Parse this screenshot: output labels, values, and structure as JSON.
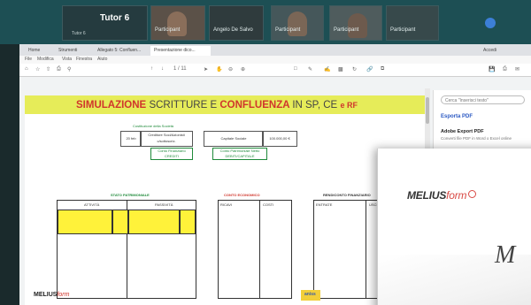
{
  "conference": {
    "tutor_label": "Tutor 6",
    "tutor_sublabel": "Tutor 6",
    "tiles": [
      {
        "name": "Participant"
      },
      {
        "name": "Angelo De Salvo"
      },
      {
        "name": "Participant"
      },
      {
        "name": "Participant"
      },
      {
        "name": "Participant"
      }
    ]
  },
  "browser": {
    "tabs": [
      {
        "label": "Home"
      },
      {
        "label": "Strumenti"
      },
      {
        "label": "Allegato 5: Confluen..."
      },
      {
        "label": "Presentazione dico..."
      }
    ],
    "menu": [
      "File",
      "Modifica",
      "Vista",
      "Finestra",
      "Aiuto"
    ],
    "account_label": "Accedi",
    "page_counter": "1 / 11"
  },
  "pdf": {
    "title_red_1": "SIMULAZIONE",
    "title_grey_1": "SCRITTURE E",
    "title_red_2": "CONFLUENZA",
    "title_grey_2": "IN SP, CE",
    "title_red_3": "e RF",
    "capital": {
      "header": "Costituzione della Società",
      "date": "20 feb",
      "col1": "Creditore Soci/Azionisti c/sottoscriz.",
      "col2": "Capitale Sociale",
      "value": "100.000,00 €",
      "green1": "Conto Finanziario CREDITI",
      "green2": "Conto Patrimoniale Netto DEBITI/CAPITALE"
    },
    "sections": [
      {
        "title": "STATO PATRIMONIALE",
        "left": "ATTIVITÀ",
        "right": "PASSIVITÀ"
      },
      {
        "title": "CONTO ECONOMICO",
        "left": "RICAVI",
        "right": "COSTI"
      },
      {
        "title": "RENDICONTO FINANZIARIO",
        "left": "ENTRATE",
        "right": "USCITE"
      }
    ],
    "footer_logo_1": "MELIUS",
    "footer_logo_2": "form",
    "footer_badge": "aniss"
  },
  "panel": {
    "search_placeholder": "Cerca \"Inserisci testo\"",
    "heading": "Esporta PDF",
    "item_title": "Adobe Export PDF",
    "item_sub": "Converti file PDF in Word o Excel online"
  },
  "card": {
    "brand_1": "MELIUS",
    "brand_2": "form",
    "script": "M"
  }
}
